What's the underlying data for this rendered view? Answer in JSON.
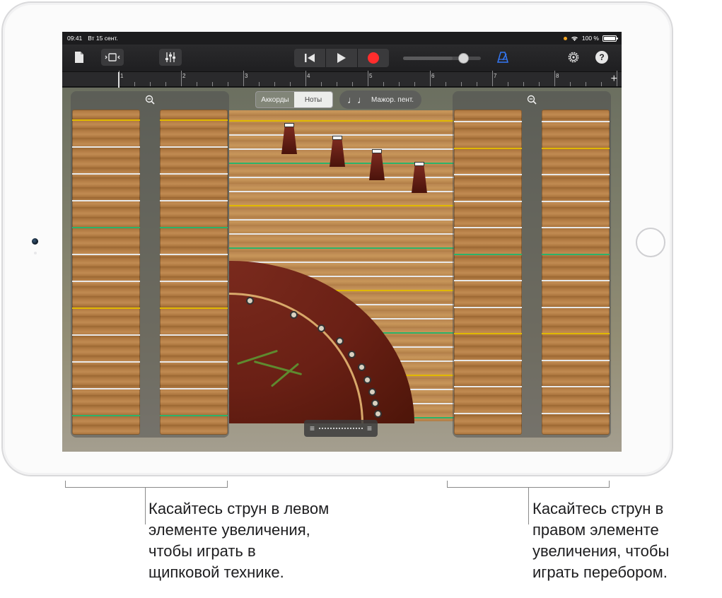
{
  "status": {
    "time": "09:41",
    "date": "Вт 15 сент.",
    "battery": "100 %"
  },
  "toolbar": {
    "help_label": "?"
  },
  "ruler": {
    "numbers": [
      "1",
      "2",
      "3",
      "4",
      "5",
      "6",
      "7",
      "8"
    ],
    "add_label": "+"
  },
  "instrument": {
    "segment_chords": "Аккорды",
    "segment_notes": "Ноты",
    "selected_segment": "Ноты",
    "scale_label": "Мажор. пент.",
    "left_zoom_icon": "zoom-out-icon",
    "right_zoom_icon": "zoom-out-icon"
  },
  "callouts": {
    "left_text": "Касайтесь струн в левом\nэлементе увеличения,\nчтобы играть в\nщипковой технике.",
    "right_text": "Касайтесь струн в\nправом элементе\nувеличения, чтобы\nиграть перебором."
  },
  "colors": {
    "string_white": "#e8e8e8",
    "string_yellow": "#e0b800",
    "string_green": "#2bb36a",
    "record": "#ff2d2d",
    "metronome": "#3478f6"
  }
}
